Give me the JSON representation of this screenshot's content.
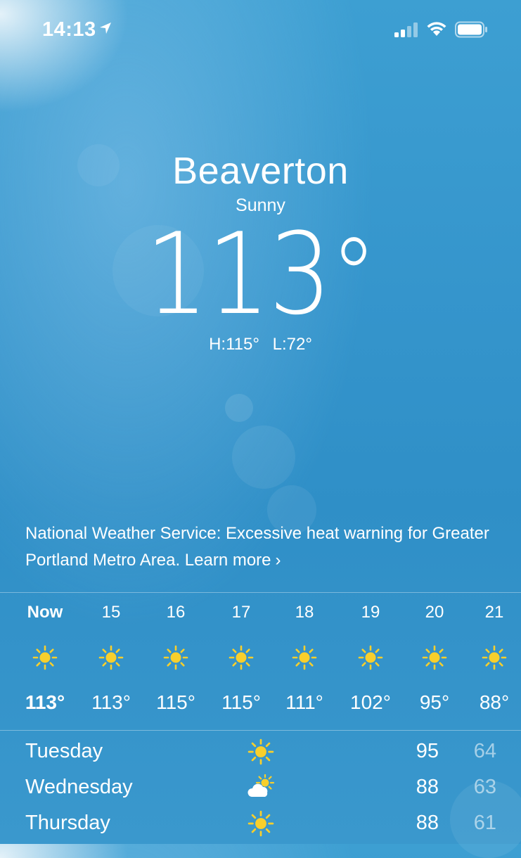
{
  "status_bar": {
    "time": "14:13",
    "location_icon": "location-arrow-icon",
    "signal_icon": "cellular-signal-icon",
    "wifi_icon": "wifi-icon",
    "battery_icon": "battery-icon"
  },
  "header": {
    "city": "Beaverton",
    "condition": "Sunny",
    "temperature": "113",
    "degree_symbol": "°",
    "high": "H:115°",
    "low": "L:72°"
  },
  "alert": {
    "text": "National Weather Service: Excessive heat warning for Greater Portland Metro Area. Learn more",
    "chevron": "›"
  },
  "hourly": [
    {
      "label": "Now",
      "icon": "sun-icon",
      "temp": "113°"
    },
    {
      "label": "15",
      "icon": "sun-icon",
      "temp": "113°"
    },
    {
      "label": "16",
      "icon": "sun-icon",
      "temp": "115°"
    },
    {
      "label": "17",
      "icon": "sun-icon",
      "temp": "115°"
    },
    {
      "label": "18",
      "icon": "sun-icon",
      "temp": "111°"
    },
    {
      "label": "19",
      "icon": "sun-icon",
      "temp": "102°"
    },
    {
      "label": "20",
      "icon": "sun-icon",
      "temp": "95°"
    },
    {
      "label": "21",
      "icon": "sun-icon",
      "temp": "88°"
    }
  ],
  "daily": [
    {
      "day": "Tuesday",
      "icon": "sun-icon",
      "high": "95",
      "low": "64"
    },
    {
      "day": "Wednesday",
      "icon": "partly-cloudy-icon",
      "high": "88",
      "low": "63"
    },
    {
      "day": "Thursday",
      "icon": "sun-icon",
      "high": "88",
      "low": "61"
    }
  ],
  "colors": {
    "sun": "#f8cf2c",
    "sky": "#3595cc"
  }
}
